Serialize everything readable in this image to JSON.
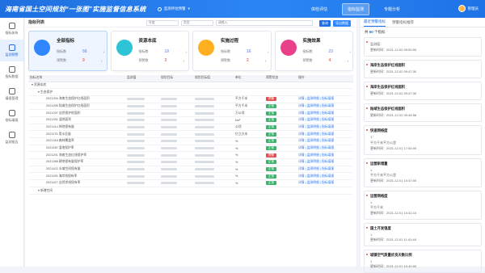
{
  "header": {
    "title": "海南省国土空间规划“一张图”实施监督信息系统",
    "region_select": "监测评估预警",
    "nav": [
      "体检评估",
      "指标监测",
      "专题分析"
    ],
    "nav_active": 1,
    "user": "管理员"
  },
  "sidebar": {
    "items": [
      {
        "label": "指标体系",
        "icon": "list-icon"
      },
      {
        "label": "监测预警",
        "icon": "monitor-icon",
        "active": true
      },
      {
        "label": "指标数据",
        "icon": "data-icon"
      },
      {
        "label": "填报管理",
        "icon": "edit-icon"
      },
      {
        "label": "指标填报",
        "icon": "form-icon"
      },
      {
        "label": "监测报告",
        "icon": "report-icon"
      }
    ]
  },
  "main": {
    "title": "指标列表",
    "filter_year": "年度",
    "filter_type": "类型",
    "filter_name": "请输入",
    "query_label": "查询",
    "export_label": "导出数据"
  },
  "cards": [
    {
      "title": "全部指标",
      "color": "#2f86ff",
      "label1": "指标数",
      "label2": "预警数",
      "v1": "58",
      "v2": "9"
    },
    {
      "title": "资源本底",
      "color": "#2ec4d8",
      "label1": "指标数",
      "label2": "预警数",
      "v1": "19",
      "v2": "3"
    },
    {
      "title": "实施过程",
      "color": "#ffb020",
      "label1": "指标数",
      "label2": "预警数",
      "v1": "16",
      "v2": "2"
    },
    {
      "title": "实施效果",
      "color": "#e8418a",
      "label1": "指标数",
      "label2": "预警数",
      "v1": "23",
      "v2": "4"
    }
  ],
  "table": {
    "headers": [
      "指标名称",
      "监测值",
      "规划目标",
      "规划目标值",
      "单位",
      "预警状态",
      "操作"
    ],
    "groups": [
      {
        "row_label": "资源本底",
        "expanded": true
      },
      {
        "row_label": "生态保护",
        "expanded": true
      }
    ],
    "rows": [
      {
        "code": "2021294",
        "name": "海南生态保护红线面积",
        "unit": "平方千米",
        "status": "预警",
        "status_color": "r"
      },
      {
        "code": "2021295",
        "name": "陆域生态保护红线面积",
        "unit": "平方千米",
        "status": "正常",
        "status_color": "g"
      },
      {
        "code": "2021297",
        "name": "自然保护地面积",
        "unit": "万公顷",
        "status": "正常",
        "status_color": "g"
      },
      {
        "code": "2021331",
        "name": "湿地面积",
        "unit": "km²",
        "status": "正常",
        "status_color": "g"
      },
      {
        "code": "2021414",
        "name": "林地保有量",
        "unit": "公顷",
        "status": "正常",
        "status_color": "g"
      },
      {
        "code": "2021175",
        "name": "用水总量",
        "unit": "亿立方米",
        "status": "正常",
        "status_color": "g"
      },
      {
        "code": "2021318",
        "name": "森林覆盖率",
        "unit": "%",
        "status": "正常",
        "status_color": "g"
      },
      {
        "code": "2021190",
        "name": "湿地保护率",
        "unit": "%",
        "status": "正常",
        "status_color": "g"
      },
      {
        "code": "2021291",
        "name": "海南生态红线保护率",
        "unit": "%",
        "status": "预警",
        "status_color": "r"
      },
      {
        "code": "2021288",
        "name": "耕地保有量保护率",
        "unit": "%",
        "status": "正常",
        "status_color": "g"
      },
      {
        "code": "2021422",
        "name": "水域空间保有量",
        "unit": "%",
        "status": "正常",
        "status_color": "g"
      },
      {
        "code": "2021195",
        "name": "海岸线保有率",
        "unit": "%",
        "status": "正常",
        "status_color": "g"
      },
      {
        "code": "2021427",
        "name": "自然岸线保有率",
        "unit": "%",
        "status": "正常",
        "status_color": "g"
      }
    ],
    "last_group": "新增空间",
    "op_detail": "详情",
    "op_monitor": "监测明细",
    "op_fill": "指标填报"
  },
  "right_panel": {
    "tabs": [
      "最近预警指标",
      "预警指标推荐"
    ],
    "count_prefix": "共",
    "count": "50",
    "count_suffix": "个指标",
    "alerts": [
      {
        "title": "",
        "lines": [
          "监测值：",
          "更新时间：2021-12-02 09:50:00"
        ]
      },
      {
        "title": "海岸生态保护红线面积",
        "lines": [
          "",
          "更新时间：2021-12-02 09:47:30"
        ]
      },
      {
        "title": "海岸生态保护红线面积",
        "lines": [
          "",
          "更新时间：2021-12-02 09:47:30"
        ]
      },
      {
        "title": "陆域生态保护红线面积",
        "lines": [
          "",
          "更新时间：2021-12-02 09:45:58"
        ]
      },
      {
        "title": "快速网络度",
        "lines": [
          "1：",
          "平方千米平方公里",
          "更新时间：2021-12-01 17:54:00"
        ]
      },
      {
        "title": "运营新增量",
        "lines": [
          "1",
          "平方千米平方公里",
          "更新时间：2021-12-01 10:47:00"
        ]
      },
      {
        "title": "运营网络度",
        "lines": [
          "1",
          "平方千米",
          "更新时间：2021-12-01 10:41:10"
        ]
      },
      {
        "title": "国土开发强度",
        "lines": [
          "1",
          "更新时间：2021-12-01 11:41:48"
        ]
      },
      {
        "title": "城镇空气质量优良天数比例",
        "lines": [
          "1",
          "更新时间：2021-12-01 10:40:00"
        ]
      }
    ]
  }
}
